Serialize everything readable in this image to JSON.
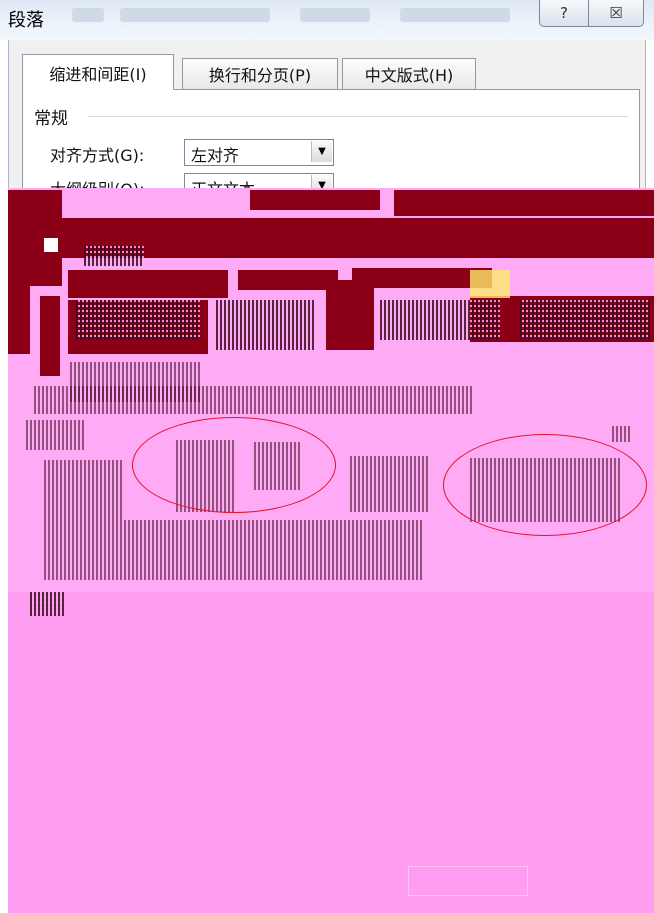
{
  "window": {
    "title": "段落",
    "help_glyph": "?",
    "close_glyph": "☒"
  },
  "tabs": [
    {
      "label": "缩进和间距(I)"
    },
    {
      "label": "换行和分页(P)"
    },
    {
      "label": "中文版式(H)"
    }
  ],
  "general": {
    "section_label": "常规",
    "alignment_label": "对齐方式(G):",
    "alignment_value": "左对齐",
    "outline_label": "大纲级别(O):",
    "outline_value": "正文文本"
  },
  "colors": {
    "corruption_pink": "#ffaaf4",
    "corruption_dark_red": "#8b0016",
    "highlight_ellipse": "#e0142a"
  }
}
